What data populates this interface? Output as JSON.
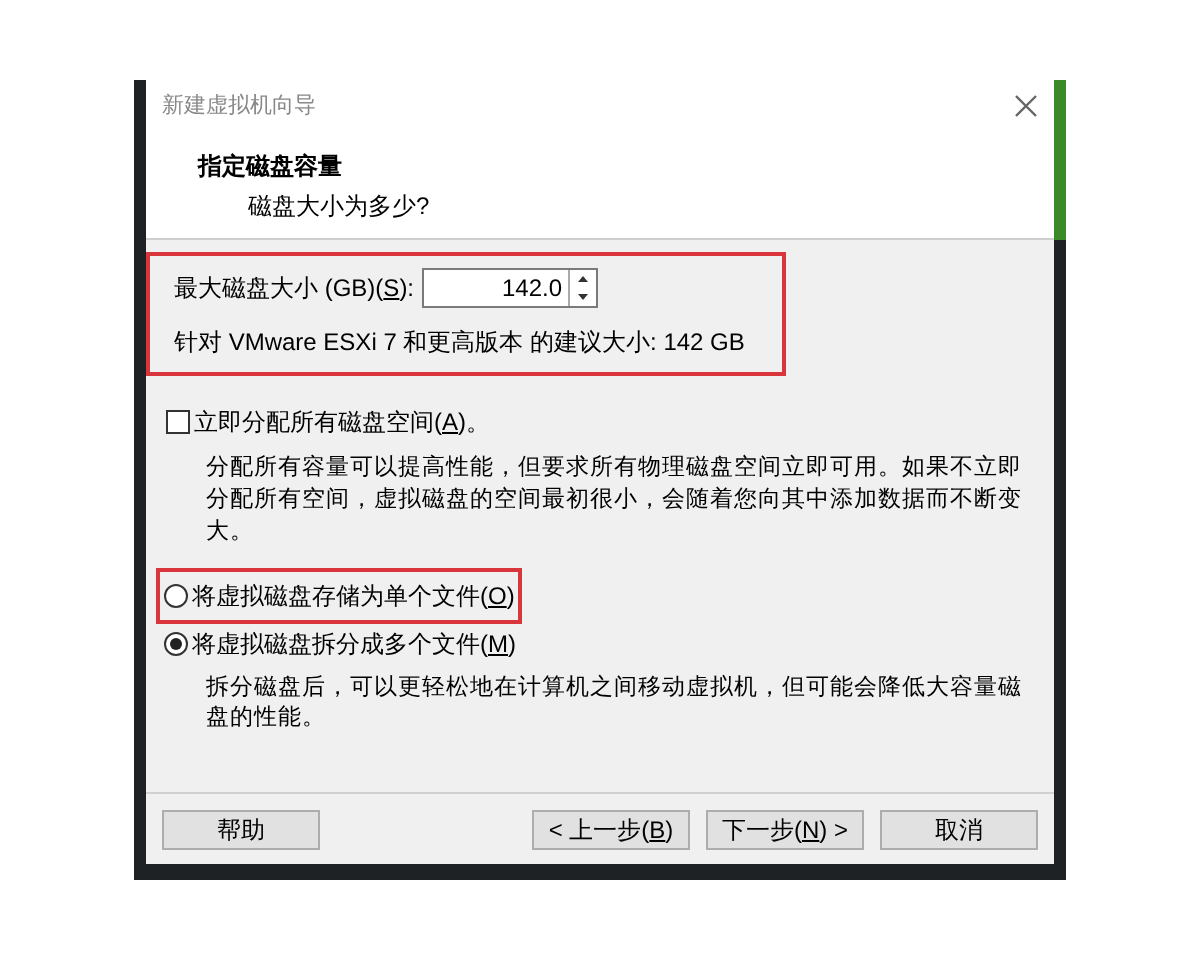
{
  "window": {
    "title": "新建虚拟机向导"
  },
  "header": {
    "title": "指定磁盘容量",
    "subtitle": "磁盘大小为多少?"
  },
  "size_field": {
    "label_before": "最大磁盘大小 (GB)(",
    "access_key": "S",
    "label_after": "):",
    "value": "142.0",
    "highlighted": true
  },
  "recommendation": "针对 VMware ESXi 7 和更高版本 的建议大小: 142 GB",
  "allocate": {
    "label_before": "立即分配所有磁盘空间(",
    "access_key": "A",
    "label_after": ")。",
    "checked": false,
    "description": "分配所有容量可以提高性能，但要求所有物理磁盘空间立即可用。如果不立即分配所有空间，虚拟磁盘的空间最初很小，会随着您向其中添加数据而不断变大。"
  },
  "storage_options": [
    {
      "label_before": "将虚拟磁盘存储为单个文件(",
      "access_key": "O",
      "label_after": ")",
      "selected": false,
      "highlighted": true
    },
    {
      "label_before": "将虚拟磁盘拆分成多个文件(",
      "access_key": "M",
      "label_after": ")",
      "selected": true,
      "highlighted": false,
      "description": "拆分磁盘后，可以更轻松地在计算机之间移动虚拟机，但可能会降低大容量磁盘的性能。"
    }
  ],
  "buttons": [
    {
      "kind": "help",
      "label_before": "帮助"
    },
    {
      "kind": "back",
      "label_before": "< 上一步(",
      "access_key": "B",
      "label_after": ")"
    },
    {
      "kind": "next",
      "label_before": "下一步(",
      "access_key": "N",
      "label_after": ") >"
    },
    {
      "kind": "cancel",
      "label_before": "取消"
    }
  ]
}
